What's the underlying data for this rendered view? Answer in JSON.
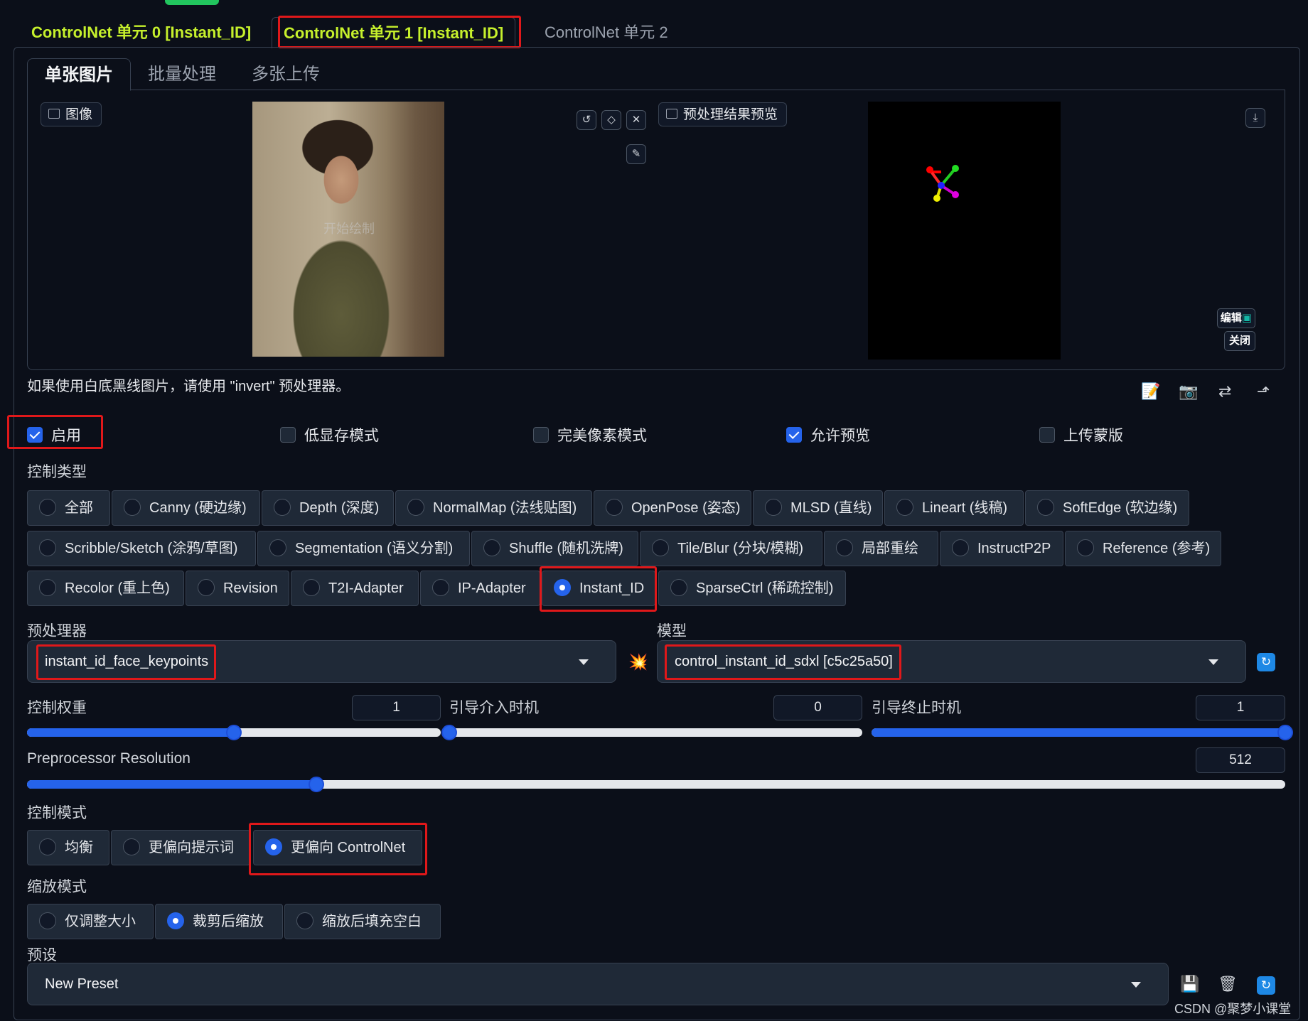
{
  "unit_tabs": [
    {
      "label": "ControlNet 单元 0 [Instant_ID]"
    },
    {
      "label": "ControlNet 单元 1 [Instant_ID]"
    },
    {
      "label": "ControlNet 单元 2"
    }
  ],
  "sub_tabs": [
    {
      "label": "单张图片"
    },
    {
      "label": "批量处理"
    },
    {
      "label": "多张上传"
    }
  ],
  "image_panel": {
    "input_label": "图像",
    "preview_label": "预处理结果预览",
    "canvas_watermark": "开始绘制",
    "edit_label": "编辑",
    "close_label": "关闭"
  },
  "hint": "如果使用白底黑线图片，请使用 \"invert\" 预处理器。",
  "options": {
    "enable": {
      "label": "启用",
      "checked": true
    },
    "low_vram": {
      "label": "低显存模式",
      "checked": false
    },
    "pixel_perfect": {
      "label": "完美像素模式",
      "checked": false
    },
    "allow_preview": {
      "label": "允许预览",
      "checked": true
    },
    "upload_mask": {
      "label": "上传蒙版",
      "checked": false
    }
  },
  "control_type": {
    "label": "控制类型",
    "selected": "Instant_ID",
    "items": [
      "全部",
      "Canny (硬边缘)",
      "Depth (深度)",
      "NormalMap (法线贴图)",
      "OpenPose (姿态)",
      "MLSD (直线)",
      "Lineart (线稿)",
      "SoftEdge (软边缘)",
      "Scribble/Sketch (涂鸦/草图)",
      "Segmentation (语义分割)",
      "Shuffle (随机洗牌)",
      "Tile/Blur (分块/模糊)",
      "局部重绘",
      "InstructP2P",
      "Reference (参考)",
      "Recolor (重上色)",
      "Revision",
      "T2I-Adapter",
      "IP-Adapter",
      "Instant_ID",
      "SparseCtrl (稀疏控制)"
    ]
  },
  "preprocessor": {
    "label": "预处理器",
    "value": "instant_id_face_keypoints"
  },
  "model": {
    "label": "模型",
    "value": "control_instant_id_sdxl [c5c25a50]"
  },
  "sliders": {
    "control_weight": {
      "label": "控制权重",
      "value": "1",
      "fraction": 0.5
    },
    "start_step": {
      "label": "引导介入时机",
      "value": "0",
      "fraction": 0.0
    },
    "end_step": {
      "label": "引导终止时机",
      "value": "1",
      "fraction": 1.0
    },
    "resolution": {
      "label": "Preprocessor Resolution",
      "value": "512",
      "fraction": 0.23
    }
  },
  "control_mode": {
    "label": "控制模式",
    "items": [
      "均衡",
      "更偏向提示词",
      "更偏向 ControlNet"
    ],
    "selected": "更偏向 ControlNet"
  },
  "resize_mode": {
    "label": "缩放模式",
    "items": [
      "仅调整大小",
      "裁剪后缩放",
      "缩放后填充空白"
    ],
    "selected": "裁剪后缩放"
  },
  "preset": {
    "label": "预设",
    "value": "New Preset"
  },
  "footer": "CSDN @聚梦小课堂",
  "colors": {
    "accent": "#2563eb",
    "highlight_box": "#e0181a",
    "active_tab_text": "#c6f02c"
  }
}
